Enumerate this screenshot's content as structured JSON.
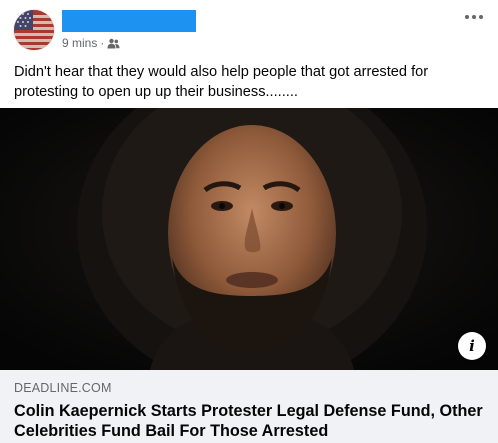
{
  "post": {
    "timestamp": "9 mins",
    "separator": "·",
    "audience_icon": "friends-icon",
    "text": "Didn't hear that they would also help people that got arrested for protesting to open up up their business........",
    "more_icon": "more-options-icon"
  },
  "link_preview": {
    "domain": "DEADLINE.COM",
    "title": "Colin Kaepernick Starts Protester Legal Defense Fund, Other Celebrities Fund Bail For Those Arrested",
    "info_icon": "info-icon"
  },
  "colors": {
    "redaction": "#1d92f0",
    "secondary_text": "#65676b",
    "footer_bg": "#f0f2f5"
  }
}
